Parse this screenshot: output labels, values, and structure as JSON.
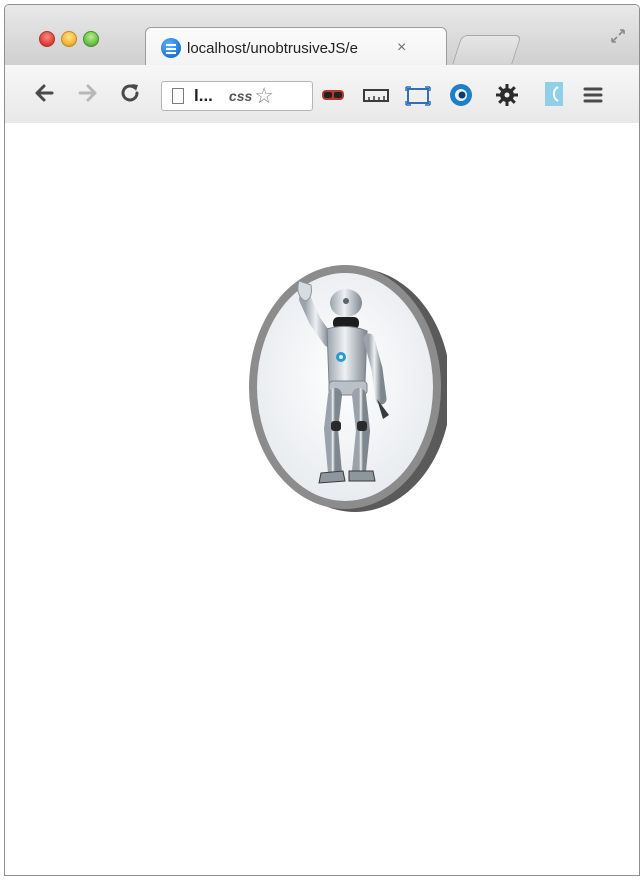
{
  "browser": {
    "tab": {
      "title": "localhost/unobtrusiveJS/e",
      "close_glyph": "×"
    },
    "url_text": "l...",
    "css_badge": "css",
    "traffic_colors": {
      "close": "#e0443a",
      "minimize": "#f4b73a",
      "maximize": "#6cc24a"
    }
  },
  "toolbar": {
    "back_icon": "back-arrow-icon",
    "forward_icon": "forward-arrow-icon",
    "reload_icon": "reload-icon",
    "extensions": [
      "mask-extension-icon",
      "ruler-extension-icon",
      "frame-extension-icon",
      "eye-extension-icon",
      "gear-extension-icon",
      "bookmark-extension-icon",
      "menu-icon"
    ]
  },
  "page": {
    "image": {
      "subject": "robot",
      "frame": "oval-bordered-picture"
    }
  }
}
